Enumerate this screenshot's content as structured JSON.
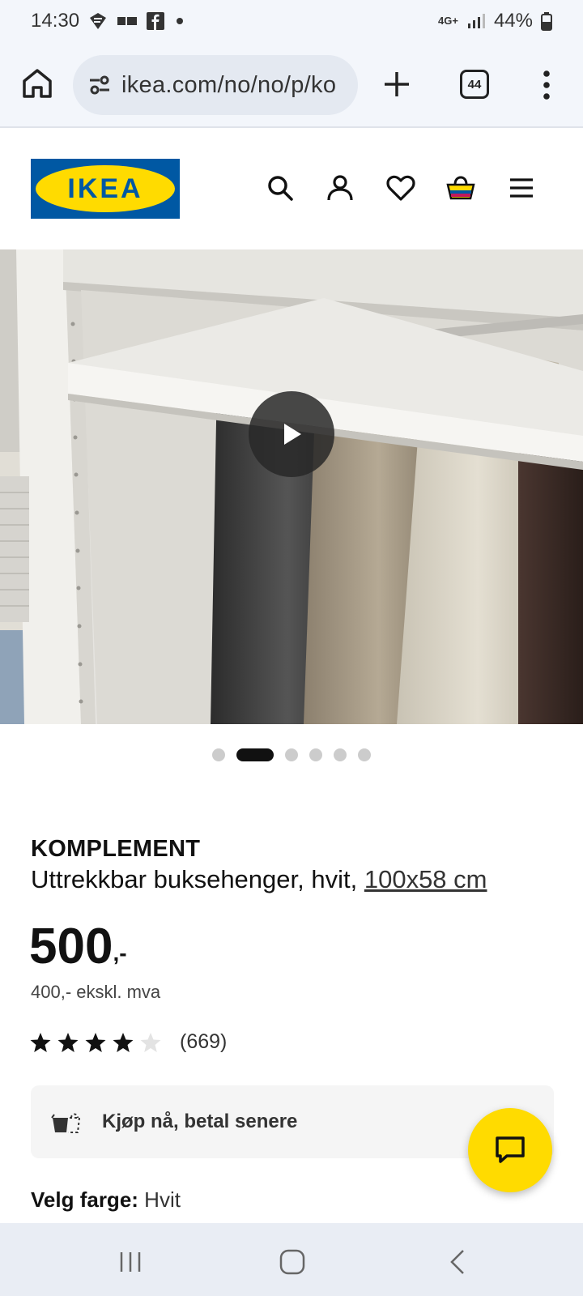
{
  "status_bar": {
    "time": "14:30",
    "network": "4G+",
    "battery": "44%",
    "icons": [
      "notification-icon",
      "chat-notification-icon",
      "facebook-icon",
      "dot-icon",
      "signal-icon",
      "battery-icon"
    ]
  },
  "browser": {
    "url": "ikea.com/no/no/p/ko",
    "tab_count": "44",
    "icons": [
      "home-icon",
      "site-settings-icon",
      "new-tab-icon",
      "tabs-icon",
      "more-menu-icon"
    ]
  },
  "header": {
    "logo_text": "IKEA",
    "icons": [
      "search-icon",
      "account-icon",
      "wishlist-icon",
      "basket-icon",
      "hamburger-menu-icon"
    ]
  },
  "gallery": {
    "total_images": 6,
    "active_index": 1
  },
  "product": {
    "brand": "KOMPLEMENT",
    "description": "Uttrekkbar buksehenger, hvit,",
    "size": "100x58 cm",
    "price": "500",
    "price_suffix": ",-",
    "price_ex_vat": "400,- ekskl. mva",
    "rating": 4,
    "rating_max": 5,
    "review_count": "(669)",
    "pay_later_label": "Kjøp nå, betal senere",
    "color_label": "Velg farge:",
    "color_value": "Hvit"
  },
  "colors": {
    "ikea_blue": "#0058a3",
    "ikea_yellow": "#ffdb00"
  },
  "nav_bar": {
    "icons": [
      "recent-apps-icon",
      "home-nav-icon",
      "back-icon"
    ]
  }
}
